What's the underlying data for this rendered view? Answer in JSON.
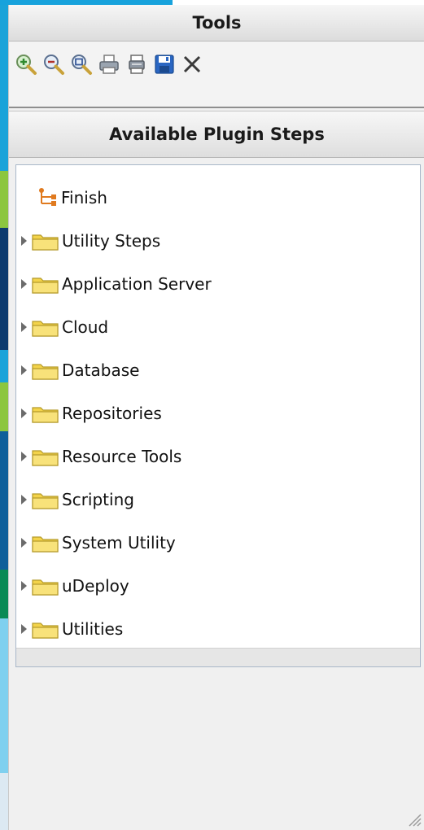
{
  "panel": {
    "title": "Tools",
    "section_title": "Available Plugin Steps"
  },
  "toolbar": {
    "buttons": [
      {
        "icon": "zoom-in-icon"
      },
      {
        "icon": "zoom-out-icon"
      },
      {
        "icon": "zoom-fit-icon"
      },
      {
        "icon": "print-icon"
      },
      {
        "icon": "print-preview-icon"
      },
      {
        "icon": "save-icon"
      },
      {
        "icon": "close-icon"
      }
    ]
  },
  "tree": {
    "items": [
      {
        "label": "Finish",
        "icon": "finish-icon",
        "expandable": false
      },
      {
        "label": "Utility Steps",
        "icon": "folder-icon",
        "expandable": true
      },
      {
        "label": "Application Server",
        "icon": "folder-icon",
        "expandable": true
      },
      {
        "label": "Cloud",
        "icon": "folder-icon",
        "expandable": true
      },
      {
        "label": "Database",
        "icon": "folder-icon",
        "expandable": true
      },
      {
        "label": "Repositories",
        "icon": "folder-icon",
        "expandable": true
      },
      {
        "label": "Resource Tools",
        "icon": "folder-icon",
        "expandable": true
      },
      {
        "label": "Scripting",
        "icon": "folder-icon",
        "expandable": true
      },
      {
        "label": "System Utility",
        "icon": "folder-icon",
        "expandable": true
      },
      {
        "label": "uDeploy",
        "icon": "folder-icon",
        "expandable": true
      },
      {
        "label": "Utilities",
        "icon": "folder-icon",
        "expandable": true
      }
    ]
  },
  "colors": {
    "accent_blue": "#1aa3d9",
    "save_blue": "#2a66c2",
    "folder_yellow": "#f3d34a"
  }
}
